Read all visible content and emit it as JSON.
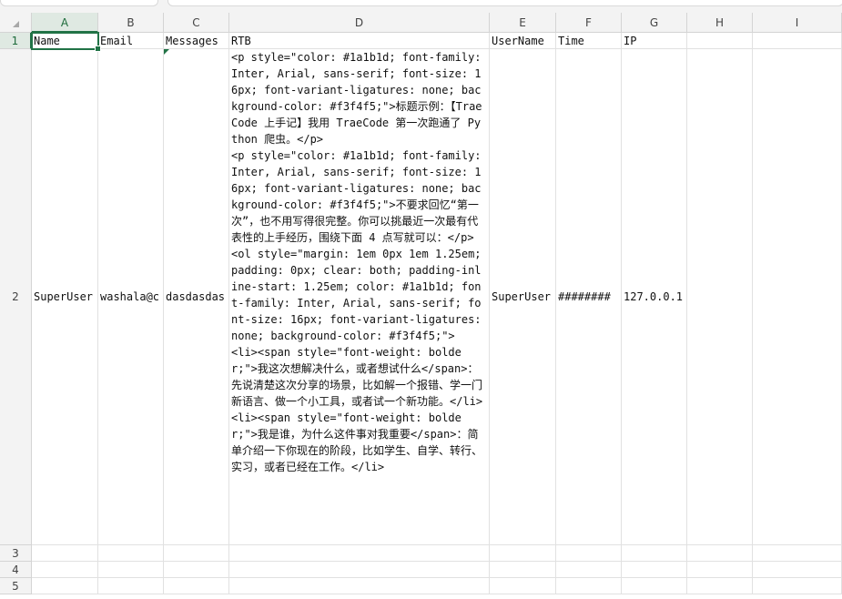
{
  "columns": [
    "A",
    "B",
    "C",
    "D",
    "E",
    "F",
    "G",
    "H",
    "I"
  ],
  "rows": [
    "1",
    "2",
    "3",
    "4",
    "5"
  ],
  "header_row": {
    "name": "Name",
    "email": "Email",
    "messages": "Messages",
    "rtb": "RTB",
    "username": "UserName",
    "time": "Time",
    "ip": "IP"
  },
  "record": {
    "name": "SuperUser",
    "email": "washala@c",
    "messages": "dasdasdas",
    "rtb": "<p style=\"color: #1a1b1d; font-family: Inter, Arial, sans-serif; font-size: 16px; font-variant-ligatures: none; background-color: #f3f4f5;\">标题示例：【TraeCode 上手记】我用 TraeCode 第一次跑通了 Python 爬虫。</p>\n<p style=\"color: #1a1b1d; font-family: Inter, Arial, sans-serif; font-size: 16px; font-variant-ligatures: none; background-color: #f3f4f5;\">不要求回忆“第一次”，也不用写得很完整。你可以挑最近一次最有代表性的上手经历，围绕下面 4 点写就可以：</p>\n<ol style=\"margin: 1em 0px 1em 1.25em; padding: 0px; clear: both; padding-inline-start: 1.25em; color: #1a1b1d; font-family: Inter, Arial, sans-serif; font-size: 16px; font-variant-ligatures: none; background-color: #f3f4f5;\">\n<li><span style=\"font-weight: bolder;\">我这次想解决什么，或者想试什么</span>：先说清楚这次分享的场景，比如解一个报错、学一门新语言、做一个小工具，或者试一个新功能。</li>\n<li><span style=\"font-weight: bolder;\">我是谁，为什么这件事对我重要</span>：简单介绍一下你现在的阶段，比如学生、自学、转行、实习，或者已经在工作。</li>",
    "username": "SuperUser",
    "time": "########",
    "ip": "127.0.0.1"
  },
  "selected_cell": "A1",
  "colors": {
    "accent": "#217346",
    "header_bg": "#f3f3f3",
    "gridline": "#e1e1e1"
  }
}
